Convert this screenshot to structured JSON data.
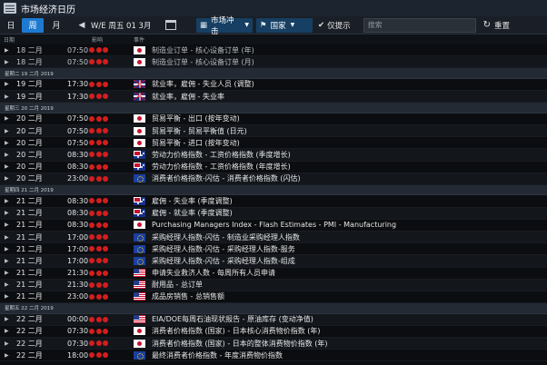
{
  "window": {
    "title": "市场经济日历"
  },
  "toolbar": {
    "day_label": "日",
    "week_label": "周",
    "month_label": "月",
    "week_range": "W/E 周五 01 3月",
    "impact_label": "市场冲击",
    "country_label": "国家",
    "filter_only_label": "仅提示",
    "search_placeholder": "搜索",
    "reset_label": "重置"
  },
  "columns": {
    "date": "日期",
    "impact": "影响",
    "event": "事件"
  },
  "colors": {
    "accent": "#1e7ad1",
    "impact_high": "#d61d1d",
    "group_bg": "#232a33",
    "background": "#0b0d10"
  },
  "rows": [
    {
      "type": "event",
      "date": "18 二月",
      "time": "07:50",
      "flag": "jp",
      "event": "制造业订单 - 核心设备订单 (年)",
      "dim": true
    },
    {
      "type": "event",
      "date": "18 二月",
      "time": "07:50",
      "flag": "jp",
      "event": "制造业订单 - 核心设备订单 (月)",
      "dim": true
    },
    {
      "type": "group",
      "label": "星期二 19 二月 2019"
    },
    {
      "type": "event",
      "date": "19 二月",
      "time": "17:30",
      "flag": "gb",
      "event": "就业率，雇佣 - 失业人员 (调整)"
    },
    {
      "type": "event",
      "date": "19 二月",
      "time": "17:30",
      "flag": "gb",
      "event": "就业率，雇佣 - 失业率"
    },
    {
      "type": "group",
      "label": "星期三 20 二月 2019"
    },
    {
      "type": "event",
      "date": "20 二月",
      "time": "07:50",
      "flag": "jp",
      "event": "贸易平衡 - 出口 (按年变动)"
    },
    {
      "type": "event",
      "date": "20 二月",
      "time": "07:50",
      "flag": "jp",
      "event": "贸易平衡 - 贸易平衡值 (日元)"
    },
    {
      "type": "event",
      "date": "20 二月",
      "time": "07:50",
      "flag": "jp",
      "event": "贸易平衡 - 进口 (按年变动)"
    },
    {
      "type": "event",
      "date": "20 二月",
      "time": "08:30",
      "flag": "au",
      "event": "劳动力价格指数 - 工资价格指数 (季度增长)"
    },
    {
      "type": "event",
      "date": "20 二月",
      "time": "08:30",
      "flag": "au",
      "event": "劳动力价格指数 - 工资价格指数 (年度增长)"
    },
    {
      "type": "event",
      "date": "20 二月",
      "time": "23:00",
      "flag": "eu",
      "event": "消费者价格指数-闪估 - 消费者价格指数 (闪估)"
    },
    {
      "type": "group",
      "label": "星期四 21 二月 2019"
    },
    {
      "type": "event",
      "date": "21 二月",
      "time": "08:30",
      "flag": "au",
      "event": "雇佣 - 失业率 (季度调整)"
    },
    {
      "type": "event",
      "date": "21 二月",
      "time": "08:30",
      "flag": "au",
      "event": "雇佣 - 就业率 (季度调整)"
    },
    {
      "type": "event",
      "date": "21 二月",
      "time": "08:30",
      "flag": "jp",
      "event": "Purchasing Managers Index - Flash Estimates - PMI - Manufacturing"
    },
    {
      "type": "event",
      "date": "21 二月",
      "time": "17:00",
      "flag": "eu",
      "event": "采购经理人指数-闪估 - 制造业采购经理人指数"
    },
    {
      "type": "event",
      "date": "21 二月",
      "time": "17:00",
      "flag": "eu",
      "event": "采购经理人指数-闪估 - 采购经理人指数-服务"
    },
    {
      "type": "event",
      "date": "21 二月",
      "time": "17:00",
      "flag": "eu",
      "event": "采购经理人指数-闪估 - 采购经理人指数-组成"
    },
    {
      "type": "event",
      "date": "21 二月",
      "time": "21:30",
      "flag": "us",
      "event": "申请失业救济人数 - 每周所有人员申请"
    },
    {
      "type": "event",
      "date": "21 二月",
      "time": "21:30",
      "flag": "us",
      "event": "耐用品 - 总订单"
    },
    {
      "type": "event",
      "date": "21 二月",
      "time": "23:00",
      "flag": "us",
      "event": "成品房销售 - 总销售额"
    },
    {
      "type": "group",
      "label": "星期五 22 二月 2019"
    },
    {
      "type": "event",
      "date": "22 二月",
      "time": "00:00",
      "flag": "us",
      "event": "EIA/DOE每周石油现状报告 - 原油库存 (变动净值)"
    },
    {
      "type": "event",
      "date": "22 二月",
      "time": "07:30",
      "flag": "jp",
      "event": "消费者价格指数 (国家) - 日本核心消费物价指数 (年)"
    },
    {
      "type": "event",
      "date": "22 二月",
      "time": "07:30",
      "flag": "jp",
      "event": "消费者价格指数 (国家) - 日本的整体消费物价指数 (年)"
    },
    {
      "type": "event",
      "date": "22 二月",
      "time": "18:00",
      "flag": "eu",
      "event": "最终消费者价格指数 - 年度消费物价指数"
    }
  ]
}
